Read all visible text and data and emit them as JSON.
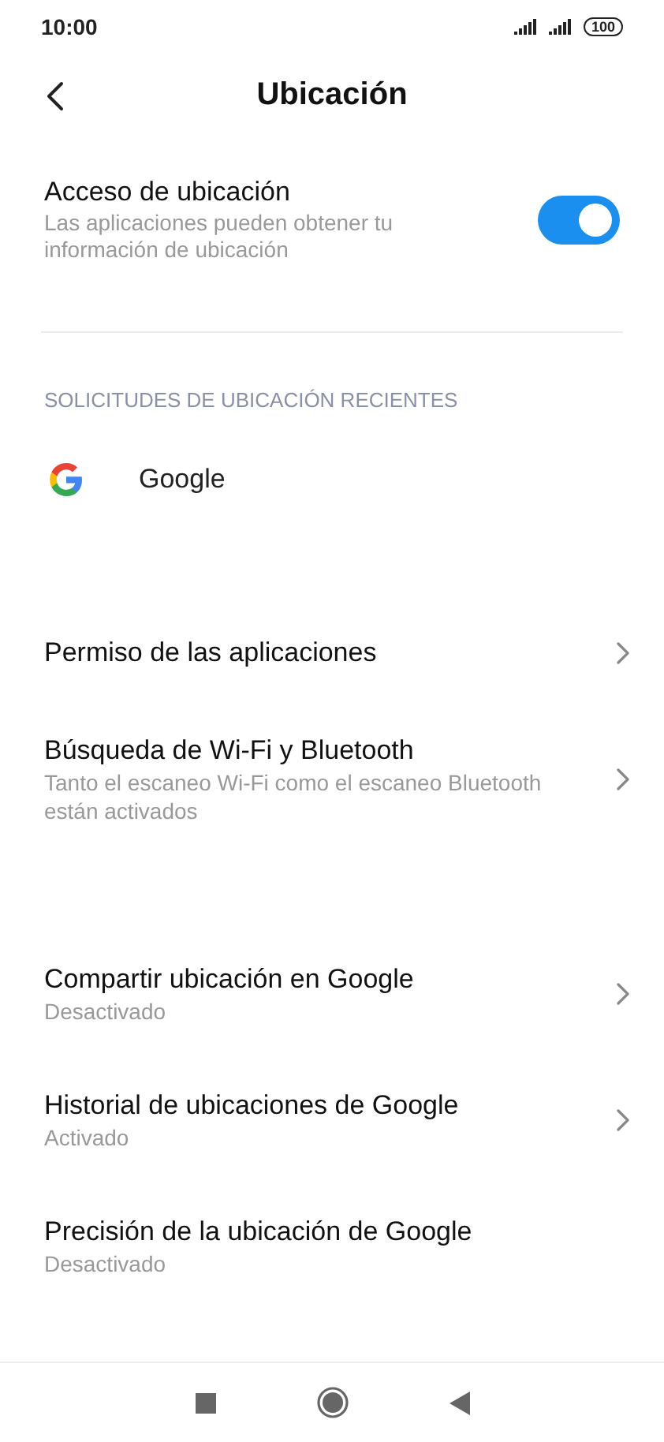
{
  "status_bar": {
    "time": "10:00",
    "battery": "100"
  },
  "header": {
    "title": "Ubicación"
  },
  "location_access": {
    "title": "Acceso de ubicación",
    "subtitle": "Las aplicaciones pueden obtener tu información de ubicación",
    "on": true
  },
  "recent_requests": {
    "heading": "SOLICITUDES DE UBICACIÓN RECIENTES",
    "apps": [
      {
        "name": "Google"
      }
    ]
  },
  "groups": [
    {
      "items": [
        {
          "kind": "link",
          "title": "Permiso de las aplicaciones"
        },
        {
          "kind": "link",
          "title": "Búsqueda de Wi-Fi y Bluetooth",
          "subtitle": "Tanto el escaneo Wi-Fi como el escaneo Bluetooth están activados"
        }
      ]
    },
    {
      "items": [
        {
          "kind": "link",
          "title": "Compartir ubicación en Google",
          "subtitle": "Desactivado"
        },
        {
          "kind": "link",
          "title": "Historial de ubicaciones de Google",
          "subtitle": "Activado"
        },
        {
          "kind": "info",
          "title": "Precisión de la ubicación de Google",
          "subtitle": "Desactivado"
        }
      ]
    }
  ]
}
